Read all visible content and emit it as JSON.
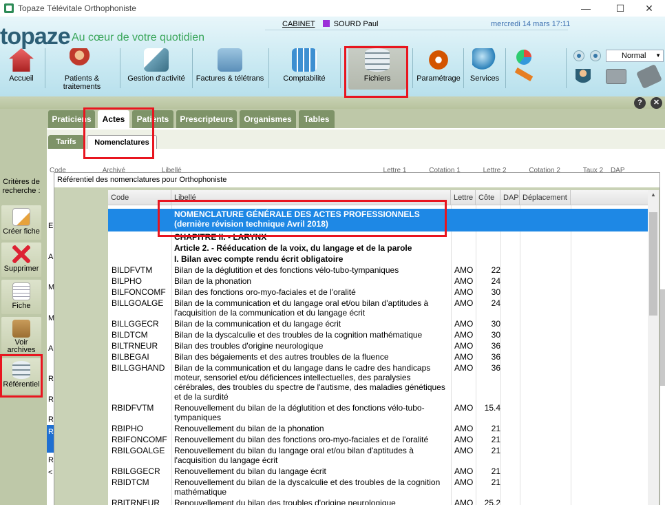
{
  "window": {
    "title": "Topaze Télévitale Orthophoniste",
    "minimize": "—",
    "maximize": "☐",
    "close": "✕"
  },
  "header": {
    "logo": "topaze",
    "tagline": "Au cœur de votre quotidien",
    "cabinet": "CABINET",
    "user": "SOURD Paul",
    "datetime": "mercredi 14 mars 17:11",
    "zoom": "Normal"
  },
  "toolbar": [
    {
      "label": "Accueil",
      "icon": "house-icon",
      "color": "#d9534f"
    },
    {
      "label": "Patients & traitements",
      "icon": "patients-icon",
      "color": "#c0392b"
    },
    {
      "label": "Gestion d'activité",
      "icon": "pen-icon",
      "color": "#6a9fb5"
    },
    {
      "label": "Factures & télétrans",
      "icon": "invoice-icon",
      "color": "#5b8fb9"
    },
    {
      "label": "Comptabilité",
      "icon": "calculator-icon",
      "color": "#3d8fd1"
    },
    {
      "label": "Fichiers",
      "icon": "database-icon",
      "color": "#5c6f7a"
    },
    {
      "label": "Paramétrage",
      "icon": "gears-icon",
      "color": "#d35400"
    },
    {
      "label": "Services",
      "icon": "globe-icon",
      "color": "#2980b9"
    }
  ],
  "tabs": [
    "Praticiens",
    "Actes",
    "Patients",
    "Prescripteurs",
    "Organismes",
    "Tables"
  ],
  "subtabs": [
    "Tarifs",
    "Nomenclatures"
  ],
  "background": {
    "headers": [
      "Code",
      "Archivé",
      "Libellé",
      "Lettre 1",
      "Cotation 1",
      "Lettre 2",
      "Cotation 2",
      "Taux 2",
      "DAP"
    ],
    "letters": [
      "E",
      "A",
      "M",
      "M",
      "A",
      "R",
      "R",
      "R",
      "R",
      "R",
      "<"
    ]
  },
  "sidebar": {
    "criteria": "Critères de recherche :",
    "buttons": [
      "Créer fiche",
      "Supprimer",
      "Fiche",
      "Voir archives",
      "Référentiel"
    ]
  },
  "dialog": {
    "title": "Référentiel des nomenclatures pour Orthophoniste",
    "columns": [
      "Code",
      "Libellé",
      "Lettre",
      "Côte",
      "DAP",
      "Déplacement"
    ],
    "rows": [
      {
        "code": "",
        "libelle": "NOMENCLATURE GÉNÉRALE DES ACTES PROFESSIONNELS  (dernière révision technique Avril 2018)",
        "lettre": "",
        "cote": "",
        "bold": true,
        "selected": true
      },
      {
        "code": "",
        "libelle": "CHAPITRE II. - LARYNX",
        "lettre": "",
        "cote": "",
        "bold": true
      },
      {
        "code": "",
        "libelle": "Article 2. - Rééducation de la voix, du langage et de la parole",
        "lettre": "",
        "cote": "",
        "bold": true
      },
      {
        "code": "",
        "libelle": "I. Bilan avec compte rendu écrit obligatoire",
        "lettre": "",
        "cote": "",
        "bold": true
      },
      {
        "code": "BILDFVTM",
        "libelle": "Bilan de la déglutition et des fonctions vélo-tubo-tympaniques",
        "lettre": "AMO",
        "cote": "22"
      },
      {
        "code": "BILPHO",
        "libelle": "Bilan de la phonation",
        "lettre": "AMO",
        "cote": "24"
      },
      {
        "code": "BILFONCOMF",
        "libelle": "Bilan des fonctions oro-myo-faciales et de l'oralité",
        "lettre": "AMO",
        "cote": "30"
      },
      {
        "code": "BILLGOALGE",
        "libelle": "Bilan de la communication et du langage oral et/ou bilan d'aptitudes à l'acquisition de la communication et du langage écrit",
        "lettre": "AMO",
        "cote": "24"
      },
      {
        "code": "BILLGGECR",
        "libelle": "Bilan de la communication et du langage écrit",
        "lettre": "AMO",
        "cote": "30"
      },
      {
        "code": "BILDTCM",
        "libelle": "Bilan de la dyscalculie et des troubles de la cognition mathématique",
        "lettre": "AMO",
        "cote": "30"
      },
      {
        "code": "BILTRNEUR",
        "libelle": "Bilan des troubles d'origine neurologique",
        "lettre": "AMO",
        "cote": "36"
      },
      {
        "code": "BILBEGAI",
        "libelle": "Bilan des bégaiements et des autres troubles de la fluence",
        "lettre": "AMO",
        "cote": "36"
      },
      {
        "code": "BILLGGHAND",
        "libelle": "Bilan de la communication et du langage dans le cadre des handicaps moteur, sensoriel et/ou déficiences intellectuelles, des paralysies cérébrales, des troubles du spectre de l'autisme, des maladies génétiques et de la surdité",
        "lettre": "AMO",
        "cote": "36"
      },
      {
        "code": "RBIDFVTM",
        "libelle": "Renouvellement du bilan de la déglutition et des fonctions vélo-tubo-tympaniques",
        "lettre": "AMO",
        "cote": "15.4"
      },
      {
        "code": "RBIPHO",
        "libelle": "Renouvellement du bilan de la phonation",
        "lettre": "AMO",
        "cote": "21"
      },
      {
        "code": "RBIFONCOMF",
        "libelle": "Renouvellement du bilan des fonctions oro-myo-faciales et de l'oralité",
        "lettre": "AMO",
        "cote": "21"
      },
      {
        "code": "RBILGOALGE",
        "libelle": "Renouvellement du bilan du langage oral et/ou bilan d'aptitudes à l'acquisition du langage écrit",
        "lettre": "AMO",
        "cote": "21"
      },
      {
        "code": "RBILGGECR",
        "libelle": "Renouvellement du bilan du langage écrit",
        "lettre": "AMO",
        "cote": "21"
      },
      {
        "code": "RBIDTCM",
        "libelle": "Renouvellement du bilan de la dyscalculie et des troubles de la cognition mathématique",
        "lettre": "AMO",
        "cote": "21"
      },
      {
        "code": "RBITRNEUR",
        "libelle": "Renouvellement du bilan des troubles d'origine neurologique",
        "lettre": "AMO",
        "cote": "25.2"
      }
    ]
  },
  "colors": {
    "highlight": "#e8151f",
    "selection": "#1e88e5",
    "tab": "#7e9368"
  }
}
